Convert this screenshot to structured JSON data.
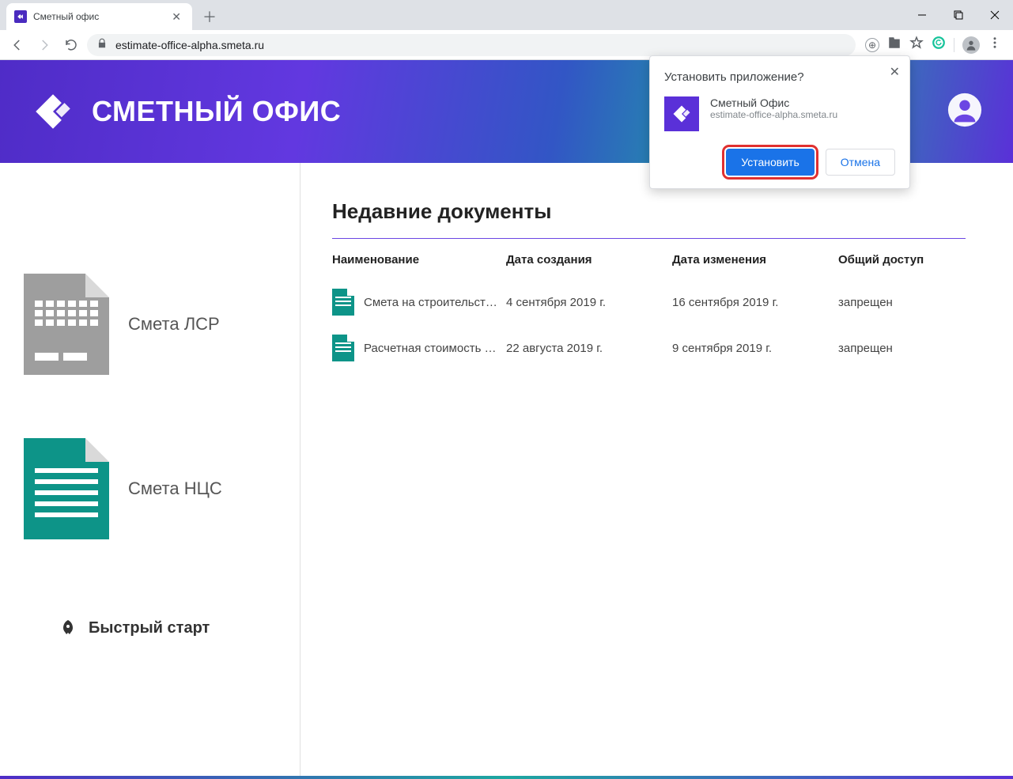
{
  "browser": {
    "tab_title": "Сметный офис",
    "url": "estimate-office-alpha.smeta.ru"
  },
  "install_popover": {
    "title": "Установить приложение?",
    "app_name": "Сметный Офис",
    "app_url": "estimate-office-alpha.smeta.ru",
    "install_label": "Установить",
    "cancel_label": "Отмена"
  },
  "header": {
    "app_title": "СМЕТНЫЙ ОФИС"
  },
  "sidebar": {
    "items": [
      {
        "label": "Смета ЛСР"
      },
      {
        "label": "Смета НЦС"
      }
    ],
    "quick_start": "Быстрый старт"
  },
  "main": {
    "section_title": "Недавние документы",
    "columns": {
      "name": "Наименование",
      "created": "Дата создания",
      "modified": "Дата изменения",
      "access": "Общий доступ"
    },
    "rows": [
      {
        "name": "Смета на строительст…",
        "created": "4 сентября 2019 г.",
        "modified": "16 сентября 2019 г.",
        "access": "запрещен"
      },
      {
        "name": "Расчетная стоимость …",
        "created": "22 августа 2019 г.",
        "modified": "9 сентября 2019 г.",
        "access": "запрещен"
      }
    ]
  }
}
